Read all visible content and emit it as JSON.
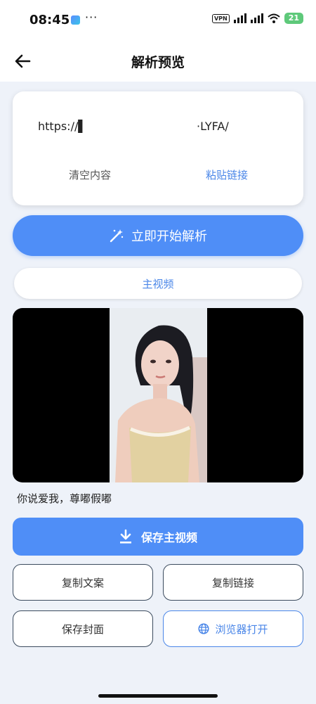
{
  "status": {
    "time": "08:45",
    "more": "···",
    "vpn": "VPN",
    "battery": "21"
  },
  "appbar": {
    "title": "解析预览"
  },
  "input": {
    "url_start": "https://▌",
    "url_end": "·LYFA/",
    "clear_label": "清空内容",
    "paste_label": "粘贴链接"
  },
  "actions": {
    "parse_label": "立即开始解析",
    "main_tab": "主视频"
  },
  "video": {
    "caption": "你说爱我，尊嘟假嘟"
  },
  "buttons": {
    "save_main": "保存主视频",
    "copy_text": "复制文案",
    "copy_link": "复制链接",
    "save_cover": "保存封面",
    "open_browser": "浏览器打开"
  },
  "colors": {
    "primary": "#4f8ef7",
    "link": "#4a86e8",
    "background": "#eef2f9"
  }
}
